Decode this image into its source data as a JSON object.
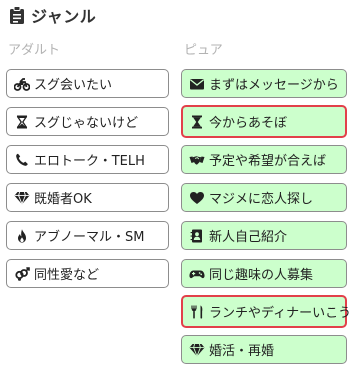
{
  "header": {
    "title": "ジャンル",
    "icon": "clipboard-icon"
  },
  "columns": {
    "adult": {
      "label": "アダルト",
      "items": [
        {
          "label": "スグ会いたい",
          "icon": "motorcycle-icon"
        },
        {
          "label": "スグじゃないけど",
          "icon": "hourglass-icon"
        },
        {
          "label": "エロトーク・TELH",
          "icon": "phone-icon"
        },
        {
          "label": "既婚者OK",
          "icon": "diamond-icon"
        },
        {
          "label": "アブノーマル・SM",
          "icon": "flame-icon"
        },
        {
          "label": "同性愛など",
          "icon": "gender-symbol-icon"
        }
      ]
    },
    "pure": {
      "label": "ピュア",
      "items": [
        {
          "label": "まずはメッセージから",
          "icon": "envelope-icon",
          "selected": false
        },
        {
          "label": "今からあそぼ",
          "icon": "hourglass-icon",
          "selected": true
        },
        {
          "label": "予定や希望が合えば",
          "icon": "handshake-icon",
          "selected": false
        },
        {
          "label": "マジメに恋人探し",
          "icon": "heart-icon",
          "selected": false
        },
        {
          "label": "新人自己紹介",
          "icon": "address-book-icon",
          "selected": false
        },
        {
          "label": "同じ趣味の人募集",
          "icon": "gamepad-icon",
          "selected": false
        },
        {
          "label": "ランチやディナーいこう",
          "icon": "utensils-icon",
          "selected": true
        },
        {
          "label": "婚活・再婚",
          "icon": "diamond-icon",
          "selected": false
        }
      ]
    }
  },
  "colors": {
    "pure_bg": "#ccffcc",
    "selected_border": "#e2404a",
    "border": "#8d8d8d",
    "column_label": "#b3b3b3"
  }
}
